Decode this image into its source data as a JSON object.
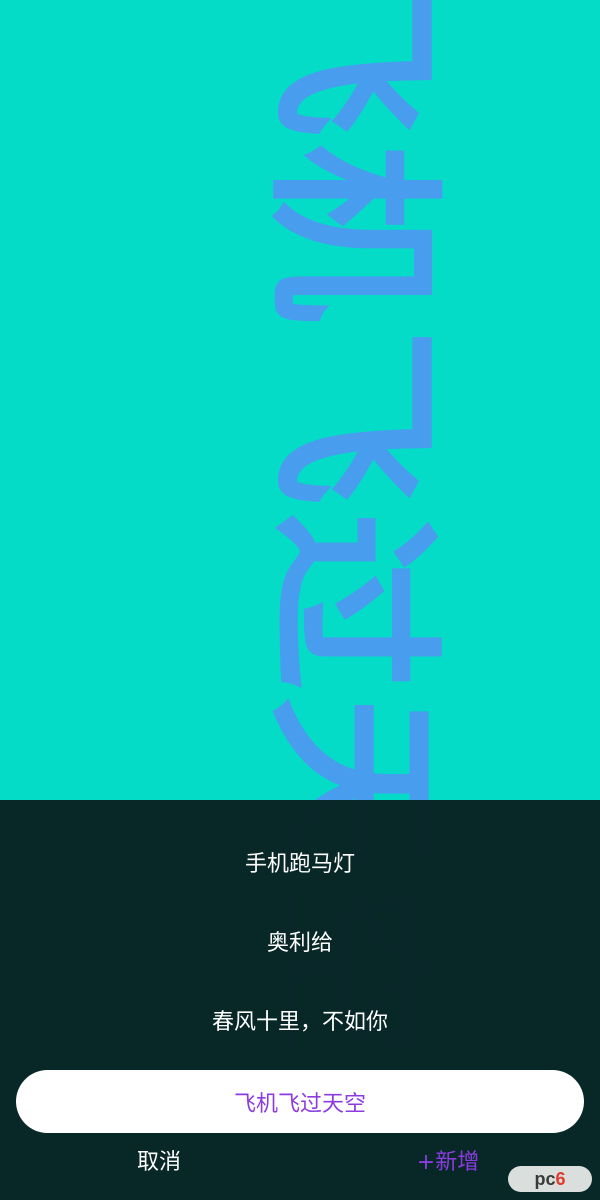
{
  "marquee": {
    "text": "飞机飞过天空",
    "text_color": "#4B9BF0",
    "background_color": "#04DCC8"
  },
  "presets": [
    {
      "label": "手机跑马灯"
    },
    {
      "label": "奥利给"
    },
    {
      "label": "春风十里，不如你"
    }
  ],
  "input": {
    "value": "飞机飞过天空",
    "text_color": "#8D3BE0"
  },
  "actions": {
    "cancel_label": "取消",
    "add_label": "+新增"
  },
  "watermark": {
    "text_pc": "pc",
    "text_six": "6"
  }
}
